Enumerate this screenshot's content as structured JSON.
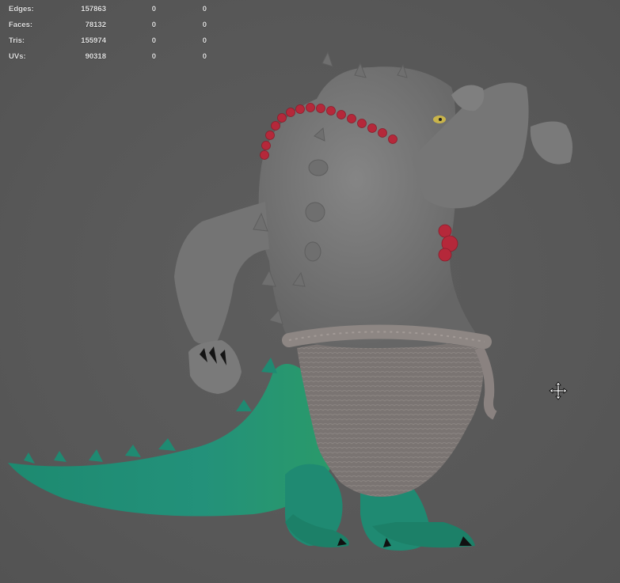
{
  "hud": {
    "rows": [
      {
        "label": "Edges:",
        "v1": "157863",
        "v2": "0",
        "v3": "0"
      },
      {
        "label": "Faces:",
        "v1": "78132",
        "v2": "0",
        "v3": "0"
      },
      {
        "label": "Tris:",
        "v1": "155974",
        "v2": "0",
        "v3": "0"
      },
      {
        "label": "UVs:",
        "v1": "90318",
        "v2": "0",
        "v3": "0"
      }
    ]
  },
  "colors": {
    "viewport_bg": "#595959",
    "body": "#707070",
    "tail": "#1f8a72",
    "beads": "#b5283a",
    "cloth": "#7c7572"
  },
  "icons": {
    "cursor": "move-cursor-icon"
  }
}
